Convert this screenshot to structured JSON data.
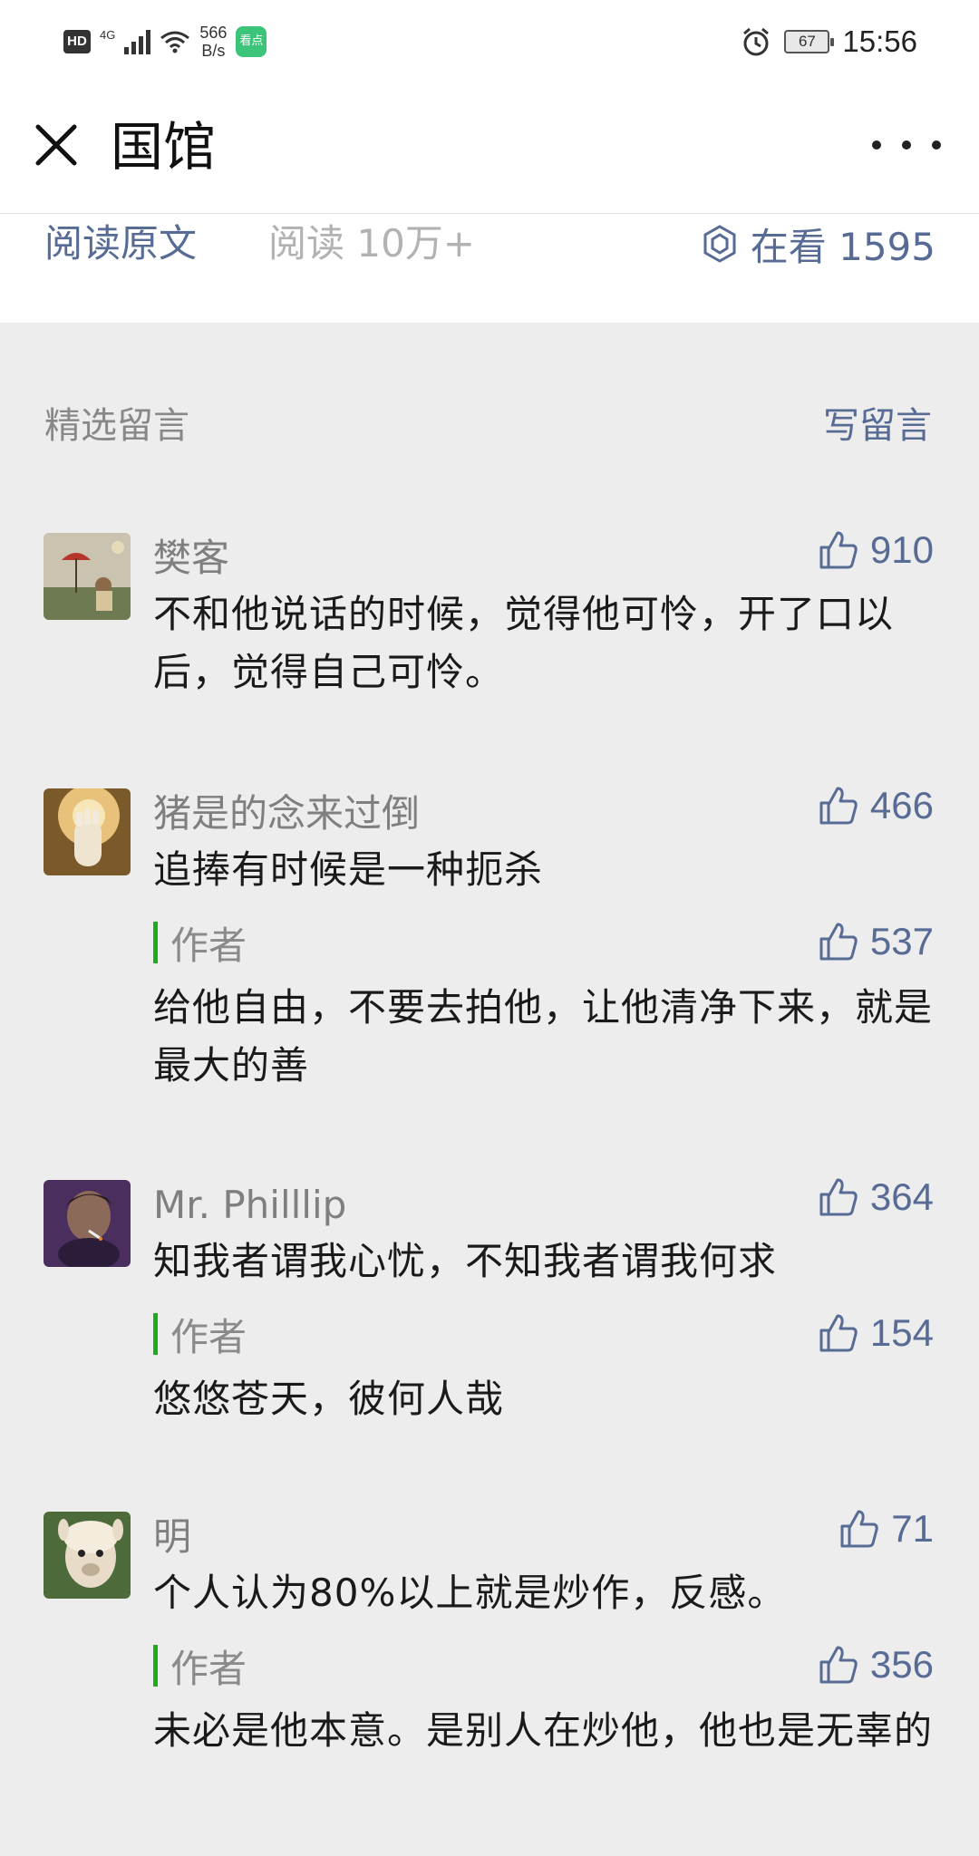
{
  "status_bar": {
    "hd": "HD",
    "network": "4G",
    "speed_value": "566",
    "speed_unit": "B/s",
    "app_badge": "看点",
    "battery": "67",
    "time": "15:56"
  },
  "header": {
    "title": "国馆"
  },
  "read_row": {
    "read_original": "阅读原文",
    "read_count": "阅读 10万+",
    "wow_label": "在看 1595"
  },
  "comments_section": {
    "label": "精选留言",
    "write_label": "写留言",
    "comments": [
      {
        "name": "樊客",
        "likes": "910",
        "text": "不和他说话的时候，觉得他可怜，开了口以后，觉得自己可怜。"
      },
      {
        "name": "猪是的念来过倒",
        "likes": "466",
        "text": "追捧有时候是一种扼杀",
        "reply": {
          "label": "作者",
          "likes": "537",
          "text": "给他自由，不要去拍他，让他清净下来，就是最大的善"
        }
      },
      {
        "name": "Mr. Philllip",
        "likes": "364",
        "text": "知我者谓我心忧，不知我者谓我何求",
        "reply": {
          "label": "作者",
          "likes": "154",
          "text": "悠悠苍天，彼何人哉"
        }
      },
      {
        "name": "明",
        "likes": "71",
        "text": "个人认为80%以上就是炒作，反感。",
        "reply": {
          "label": "作者",
          "likes": "356",
          "text": "未必是他本意。是别人在炒他，他也是无辜的"
        }
      }
    ]
  },
  "colors": {
    "link": "#576b95",
    "author_bar": "#1aad19",
    "background": "#ededed"
  }
}
